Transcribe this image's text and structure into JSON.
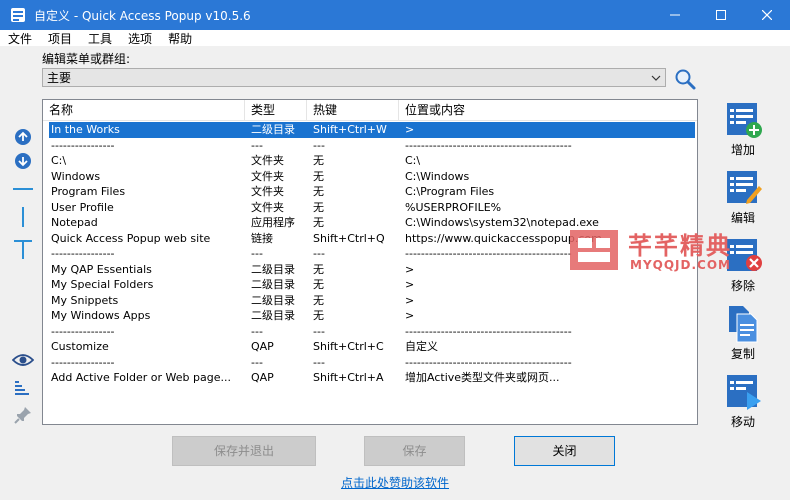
{
  "window": {
    "title": "自定义 - Quick Access Popup v10.5.6",
    "controls": [
      "minimize-icon",
      "maximize-icon",
      "close-icon"
    ]
  },
  "menu": [
    "文件",
    "项目",
    "工具",
    "选项",
    "帮助"
  ],
  "group_label": "编辑菜单或群组:",
  "combo": {
    "value": "主要"
  },
  "list": {
    "headers": [
      "名称",
      "类型",
      "热键",
      "位置或内容"
    ],
    "rows": [
      [
        "In the Works",
        "二级目录",
        "Shift+Ctrl+W",
        ">"
      ],
      [
        "----------------",
        "---",
        "---",
        "------------------------------------------"
      ],
      [
        "C:\\",
        "文件夹",
        "无",
        "C:\\"
      ],
      [
        "Windows",
        "文件夹",
        "无",
        "C:\\Windows"
      ],
      [
        "Program Files",
        "文件夹",
        "无",
        "C:\\Program Files"
      ],
      [
        "User Profile",
        "文件夹",
        "无",
        "%USERPROFILE%"
      ],
      [
        "Notepad",
        "应用程序",
        "无",
        "C:\\Windows\\system32\\notepad.exe"
      ],
      [
        "Quick Access Popup web site",
        "链接",
        "Shift+Ctrl+Q",
        "https://www.quickaccesspopup.com"
      ],
      [
        "----------------",
        "---",
        "---",
        "------------------------------------------"
      ],
      [
        "My QAP Essentials",
        "二级目录",
        "无",
        ">"
      ],
      [
        "My Special Folders",
        "二级目录",
        "无",
        ">"
      ],
      [
        "My Snippets",
        "二级目录",
        "无",
        ">"
      ],
      [
        "My Windows Apps",
        "二级目录",
        "无",
        ">"
      ],
      [
        "----------------",
        "---",
        "---",
        "------------------------------------------"
      ],
      [
        "Customize",
        "QAP",
        "Shift+Ctrl+C",
        "自定义"
      ],
      [
        "----------------",
        "---",
        "---",
        "------------------------------------------"
      ],
      [
        "Add Active Folder or Web page...",
        "QAP",
        "Shift+Ctrl+A",
        "增加Active类型文件夹或网页..."
      ]
    ],
    "selected_index": 0
  },
  "left_tools": [
    "move-up-icon",
    "move-down-icon",
    "separator-icon",
    "column-break-icon",
    "text-separator-icon",
    "eye-icon",
    "sort-icon",
    "pin-icon"
  ],
  "right_tools": [
    {
      "label": "增加",
      "icon": "add-icon"
    },
    {
      "label": "编辑",
      "icon": "edit-icon"
    },
    {
      "label": "移除",
      "icon": "remove-icon"
    },
    {
      "label": "复制",
      "icon": "copy-icon"
    },
    {
      "label": "移动",
      "icon": "move-icon"
    }
  ],
  "buttons": {
    "save_exit": "保存并退出",
    "save": "保存",
    "close": "关闭"
  },
  "donate_link": "点击此处赞助该软件",
  "watermark": {
    "big": "芊芊精典",
    "small": "MYQQJD.COM"
  },
  "colors": {
    "titlebar": "#2b78d6",
    "selection": "#1a73d0",
    "accent_green": "#2fa84f",
    "accent_red": "#e04040"
  }
}
